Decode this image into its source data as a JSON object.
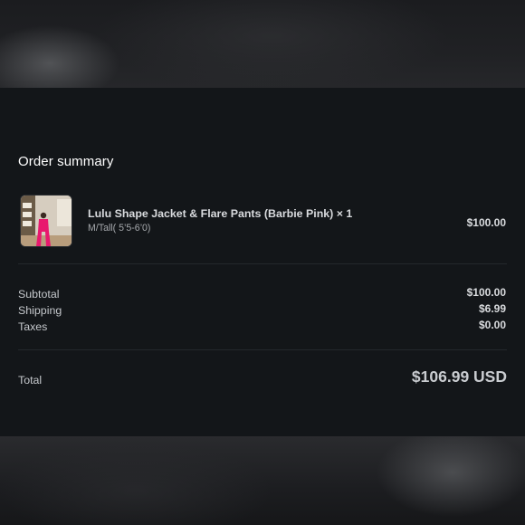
{
  "summary": {
    "title": "Order summary",
    "item": {
      "name": "Lulu Shape Jacket & Flare Pants (Barbie Pink) × 1",
      "variant": "M/Tall( 5’5-6’0)",
      "price": "$100.00"
    },
    "lines": [
      {
        "label": "Subtotal",
        "value": "$100.00"
      },
      {
        "label": "Shipping",
        "value": "$6.99"
      },
      {
        "label": "Taxes",
        "value": "$0.00"
      }
    ],
    "total": {
      "label": "Total",
      "value": "$106.99 USD"
    }
  },
  "colors": {
    "panel_bg": "#131619",
    "text_primary": "#ffffff",
    "text_muted": "#a6a9ad",
    "accent_pink": "#e8196e"
  }
}
